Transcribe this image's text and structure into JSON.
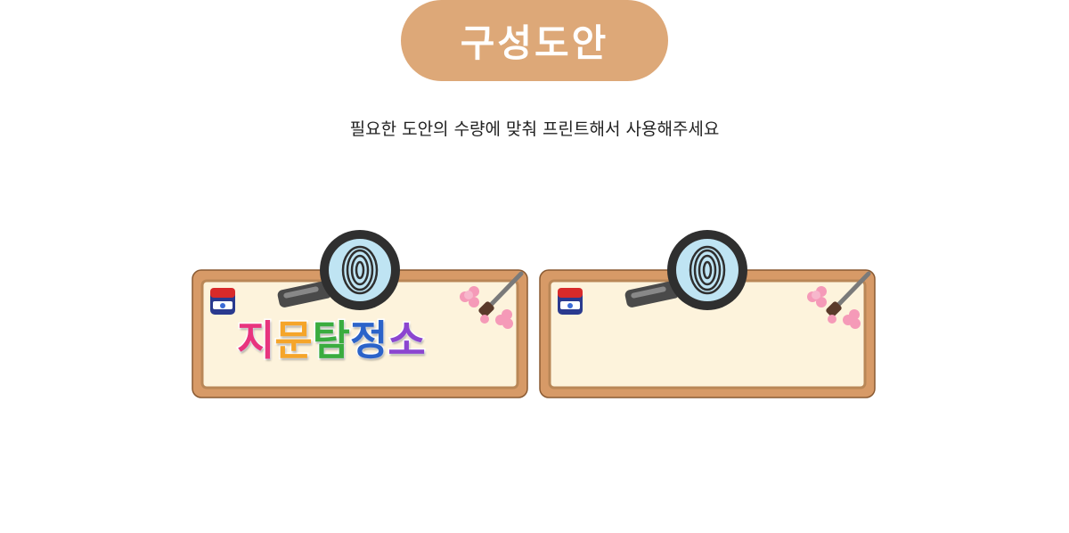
{
  "header": {
    "title": "구성도안",
    "subtitle": "필요한 도안의 수량에 맞춰 프린트해서 사용해주세요"
  },
  "colors": {
    "pill": "#dda878",
    "frame_outer": "#d79a67",
    "frame_inner_border": "#b98757",
    "board_fill": "#fdf3dc",
    "char_colors": [
      "#e8347e",
      "#f5a52a",
      "#3aac3f",
      "#2b63c9",
      "#8b45d0"
    ]
  },
  "signs": [
    {
      "label_chars": [
        "지",
        "문",
        "탐",
        "정",
        "소"
      ]
    },
    {
      "label_chars": []
    }
  ],
  "icons": [
    "ink-jar-icon",
    "magnifying-glass-fingerprint-icon",
    "brush-icon",
    "flower-icon"
  ]
}
